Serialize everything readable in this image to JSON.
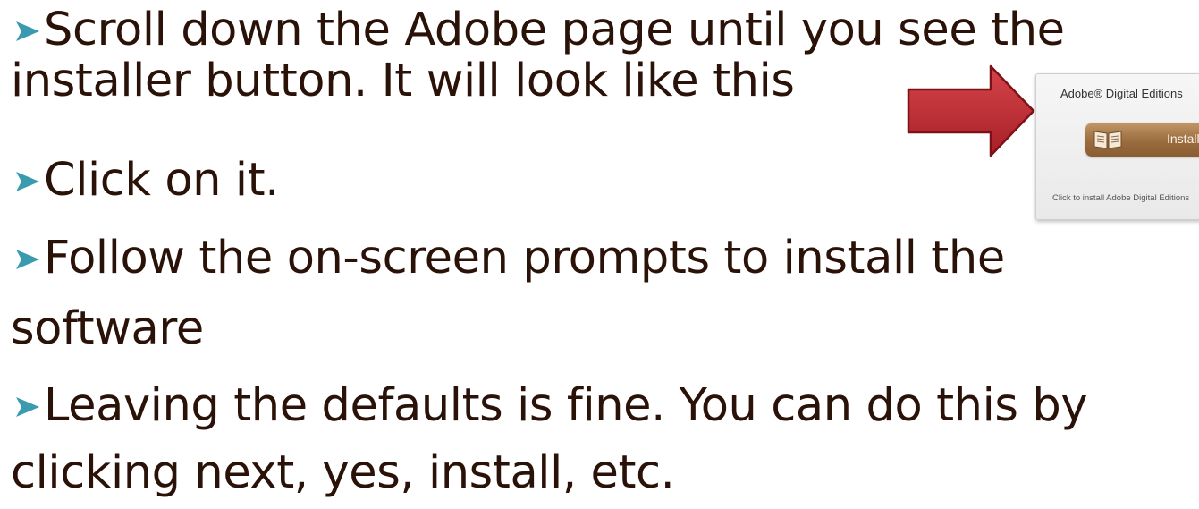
{
  "bullets": [
    {
      "lines": [
        "Scroll down the Adobe page until you see the",
        "installer button.  It will look like this"
      ]
    },
    {
      "lines": [
        "Click on it."
      ]
    },
    {
      "lines": [
        "Follow the on-screen prompts to install the",
        "software"
      ]
    },
    {
      "lines": [
        "Leaving the defaults is fine. You can do this by",
        "clicking next, yes, install, etc."
      ]
    }
  ],
  "installer": {
    "title": "Adobe® Digital Editions",
    "button_label": "Install",
    "note": "Click to install Adobe Digital Editions"
  },
  "colors": {
    "text": "#2a1208",
    "bullet": "#3a9ab0",
    "arrow": "#b8282f",
    "button": "#9a6c3e"
  },
  "icons": {
    "bullet": "arrowhead-bullet-icon",
    "arrow": "red-arrow-icon",
    "book": "open-book-icon"
  }
}
